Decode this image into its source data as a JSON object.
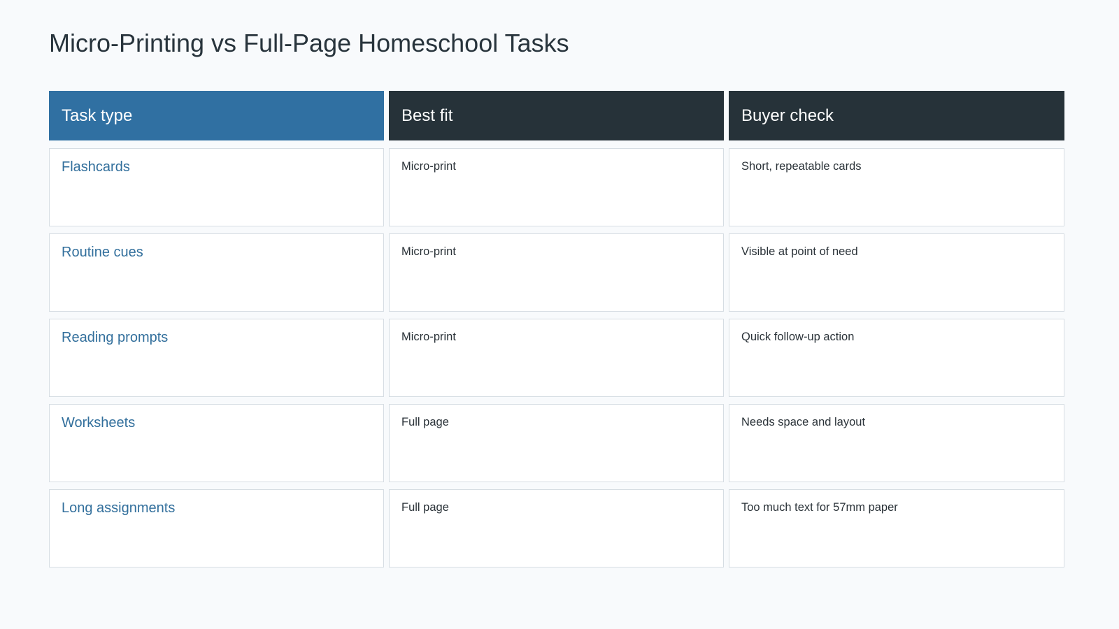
{
  "title": "Micro-Printing vs Full-Page Homeschool Tasks",
  "colors": {
    "accent_header": "#3070a2",
    "dark_header": "#263239",
    "task_text": "#326f9c",
    "page_background": "#f8fafc"
  },
  "table": {
    "headers": [
      "Task type",
      "Best fit",
      "Buyer check"
    ],
    "rows": [
      [
        "Flashcards",
        "Micro-print",
        "Short, repeatable cards"
      ],
      [
        "Routine cues",
        "Micro-print",
        "Visible at point of need"
      ],
      [
        "Reading prompts",
        "Micro-print",
        "Quick follow-up action"
      ],
      [
        "Worksheets",
        "Full page",
        "Needs space and layout"
      ],
      [
        "Long assignments",
        "Full page",
        "Too much text for 57mm paper"
      ]
    ]
  }
}
